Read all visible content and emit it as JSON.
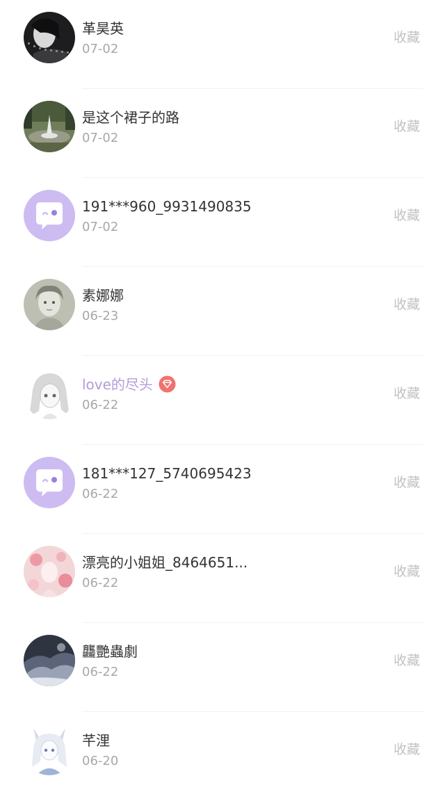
{
  "collect_label": "收藏",
  "items": [
    {
      "name": "革昊英",
      "date": "07-02",
      "avatar": "dark-portrait"
    },
    {
      "name": "是这个裙子的路",
      "date": "07-02",
      "avatar": "fountain-photo"
    },
    {
      "name": "191***960_9931490835",
      "date": "07-02",
      "avatar": "default-chat-bubble"
    },
    {
      "name": "素娜娜",
      "date": "06-23",
      "avatar": "sketch-portrait"
    },
    {
      "name": "love的尽头",
      "date": "06-22",
      "avatar": "anime-girl-sketch",
      "vip": true
    },
    {
      "name": "181***127_5740695423",
      "date": "06-22",
      "avatar": "default-chat-bubble"
    },
    {
      "name": "漂亮的小姐姐_8464651...",
      "date": "06-22",
      "avatar": "pink-floral"
    },
    {
      "name": "龘艷蟲劇",
      "date": "06-22",
      "avatar": "dark-landscape"
    },
    {
      "name": "芊浬",
      "date": "06-20",
      "avatar": "anime-fox-girl"
    }
  ],
  "colors": {
    "vip_name": "#b39bd8",
    "default_avatar_bg": "#cdbcf2",
    "badge": "#f0736f"
  }
}
